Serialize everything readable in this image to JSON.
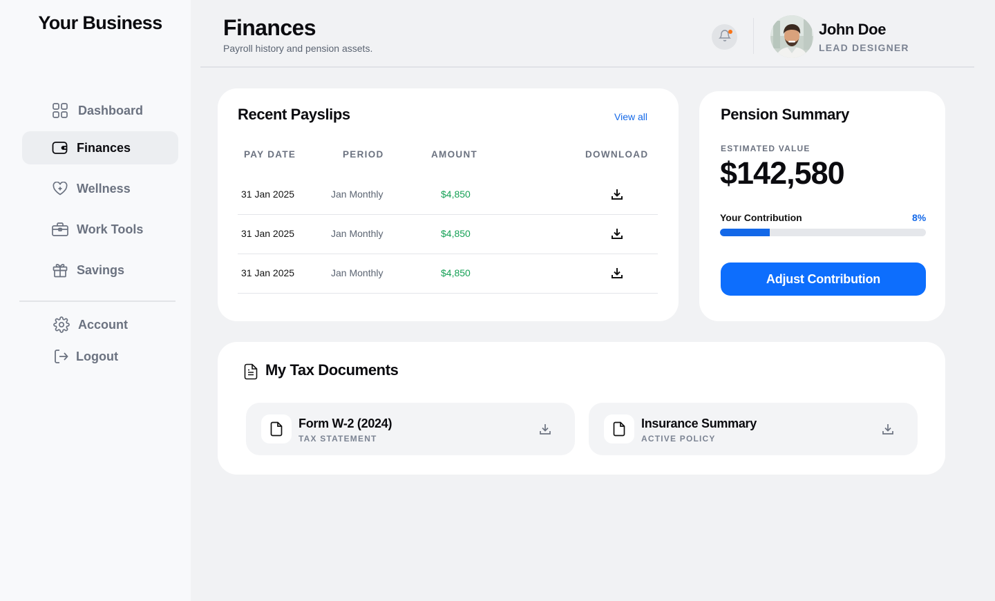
{
  "brand": "Your Business",
  "sidebar": {
    "items": [
      {
        "label": "Dashboard",
        "icon": "grid-icon"
      },
      {
        "label": "Finances",
        "icon": "wallet-icon",
        "active": true
      },
      {
        "label": "Wellness",
        "icon": "heart-plus-icon"
      },
      {
        "label": "Work Tools",
        "icon": "briefcase-icon"
      },
      {
        "label": "Savings",
        "icon": "gift-icon"
      }
    ],
    "bottom": [
      {
        "label": "Account",
        "icon": "gear-icon"
      },
      {
        "label": "Logout",
        "icon": "logout-icon"
      }
    ]
  },
  "header": {
    "title": "Finances",
    "subtitle": "Payroll history and pension assets.",
    "user": {
      "name": "John Doe",
      "role": "LEAD DESIGNER"
    }
  },
  "payslips": {
    "title": "Recent Payslips",
    "view_all": "View all",
    "columns": [
      "PAY DATE",
      "PERIOD",
      "AMOUNT",
      "DOWNLOAD"
    ],
    "rows": [
      {
        "date": "31 Jan 2025",
        "period": "Jan Monthly",
        "amount": "$4,850"
      },
      {
        "date": "31 Jan 2025",
        "period": "Jan Monthly",
        "amount": "$4,850"
      },
      {
        "date": "31 Jan 2025",
        "period": "Jan Monthly",
        "amount": "$4,850"
      }
    ]
  },
  "pension": {
    "title": "Pension Summary",
    "estimated_label": "ESTIMATED VALUE",
    "estimated_value": "$142,580",
    "contribution_label": "Your Contribution",
    "contribution_pct": "8%",
    "contribution_fill": 0.24,
    "button": "Adjust Contribution"
  },
  "tax": {
    "title": "My Tax Documents",
    "docs": [
      {
        "name": "Form W-2 (2024)",
        "sub": "TAX STATEMENT"
      },
      {
        "name": "Insurance Summary",
        "sub": "ACTIVE POLICY"
      }
    ]
  },
  "colors": {
    "accent": "#0d6efd",
    "amount": "#15a055",
    "notification": "#f97316"
  }
}
